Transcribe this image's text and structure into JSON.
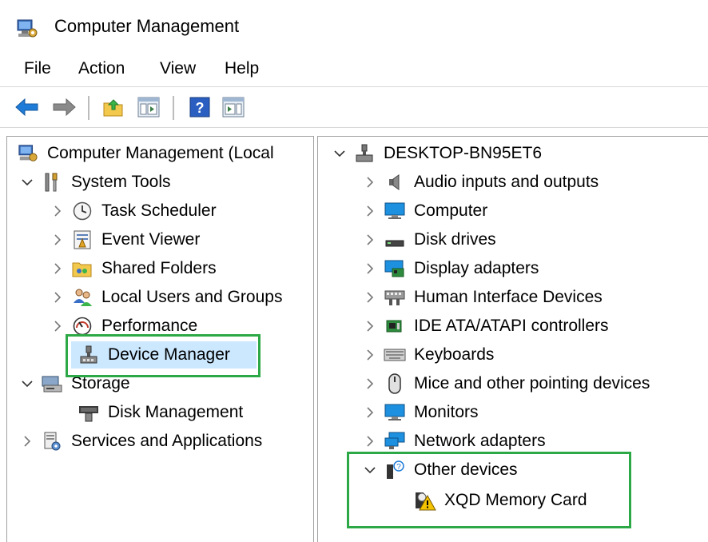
{
  "window": {
    "title": "Computer Management",
    "icon": "computer-management-icon"
  },
  "menu": [
    "File",
    "Action",
    "View",
    "Help"
  ],
  "toolbar": {
    "buttons": [
      {
        "name": "back-button",
        "icon": "arrow-left-icon"
      },
      {
        "name": "forward-button",
        "icon": "arrow-right-icon"
      },
      {
        "name": "up-one-level-button",
        "icon": "folder-up-icon"
      },
      {
        "name": "show-hide-console-tree-button",
        "icon": "console-tree-icon"
      },
      {
        "name": "help-button",
        "icon": "help-icon"
      },
      {
        "name": "show-hide-action-pane-button",
        "icon": "action-pane-icon"
      }
    ]
  },
  "left_tree": {
    "root": "Computer Management (Local",
    "items": [
      {
        "label": "System Tools",
        "expanded": true
      },
      {
        "label": "Task Scheduler"
      },
      {
        "label": "Event Viewer"
      },
      {
        "label": "Shared Folders"
      },
      {
        "label": "Local Users and Groups"
      },
      {
        "label": "Performance"
      },
      {
        "label": "Device Manager",
        "selected": true
      },
      {
        "label": "Storage",
        "expanded": true
      },
      {
        "label": "Disk Management"
      },
      {
        "label": "Services and Applications"
      }
    ]
  },
  "right_tree": {
    "computer": "DESKTOP-BN95ET6",
    "categories": [
      "Audio inputs and outputs",
      "Computer",
      "Disk drives",
      "Display adapters",
      "Human Interface Devices",
      "IDE ATA/ATAPI controllers",
      "Keyboards",
      "Mice and other pointing devices",
      "Monitors",
      "Network adapters",
      "Other devices"
    ],
    "other_device_child": "XQD Memory Card"
  },
  "colors": {
    "highlight_box": "#2da846",
    "selection": "#cce8ff",
    "accent": "#1e7bd7"
  }
}
